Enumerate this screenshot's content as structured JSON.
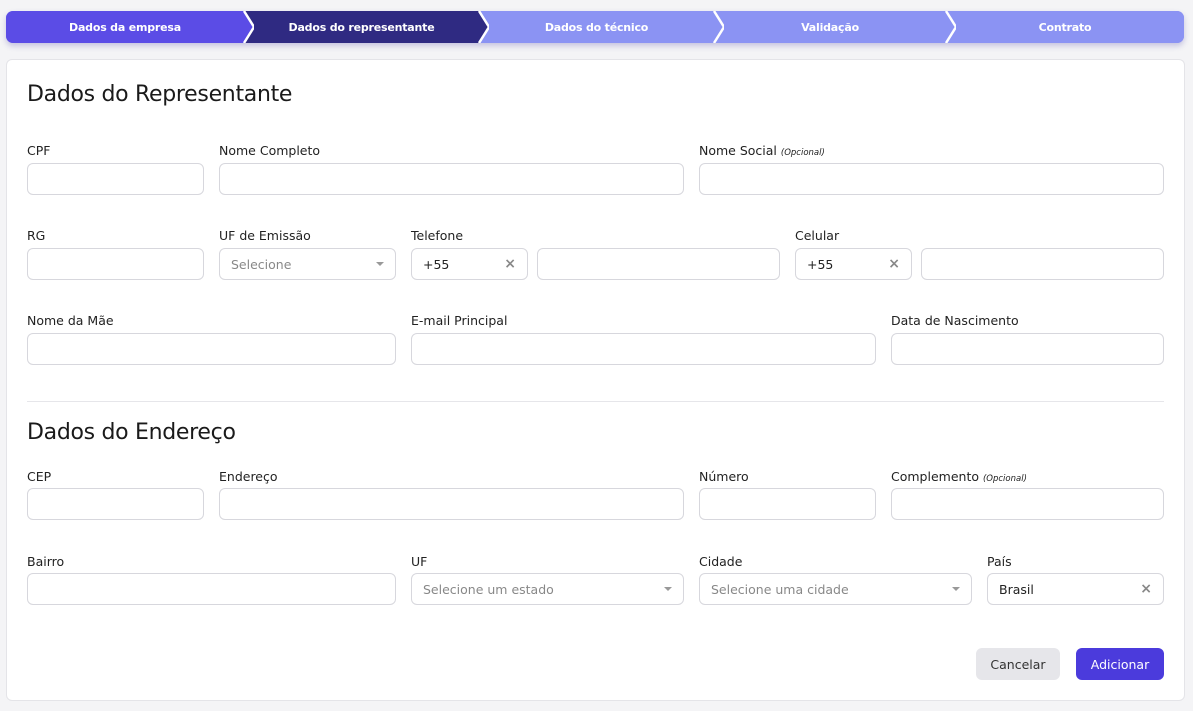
{
  "stepper": {
    "steps": [
      {
        "label": "Dados da empresa"
      },
      {
        "label": "Dados do representante"
      },
      {
        "label": "Dados do técnico"
      },
      {
        "label": "Validação"
      },
      {
        "label": "Contrato"
      }
    ]
  },
  "representante": {
    "title": "Dados do Representante",
    "cpf_label": "CPF",
    "nome_completo_label": "Nome Completo",
    "nome_social_label": "Nome Social",
    "optional_tag": "(Opcional)",
    "rg_label": "RG",
    "uf_emissao_label": "UF de Emissão",
    "uf_emissao_placeholder": "Selecione",
    "telefone_label": "Telefone",
    "telefone_ddi": "+55",
    "celular_label": "Celular",
    "celular_ddi": "+55",
    "nome_mae_label": "Nome da Mãe",
    "email_label": "E-mail Principal",
    "nascimento_label": "Data de Nascimento"
  },
  "endereco": {
    "title": "Dados do Endereço",
    "cep_label": "CEP",
    "endereco_label": "Endereço",
    "numero_label": "Número",
    "complemento_label": "Complemento",
    "optional_tag": "(Opcional)",
    "bairro_label": "Bairro",
    "uf_label": "UF",
    "uf_placeholder": "Selecione um estado",
    "cidade_label": "Cidade",
    "cidade_placeholder": "Selecione uma cidade",
    "pais_label": "País",
    "pais_value": "Brasil"
  },
  "actions": {
    "cancel_label": "Cancelar",
    "add_label": "Adicionar"
  },
  "icons": {
    "clear": "×"
  },
  "colors": {
    "step_done": "#5b4ce6",
    "step_active": "#2f2a82",
    "step_pending": "#8b93f3",
    "primary_button": "#4b3bdc"
  }
}
